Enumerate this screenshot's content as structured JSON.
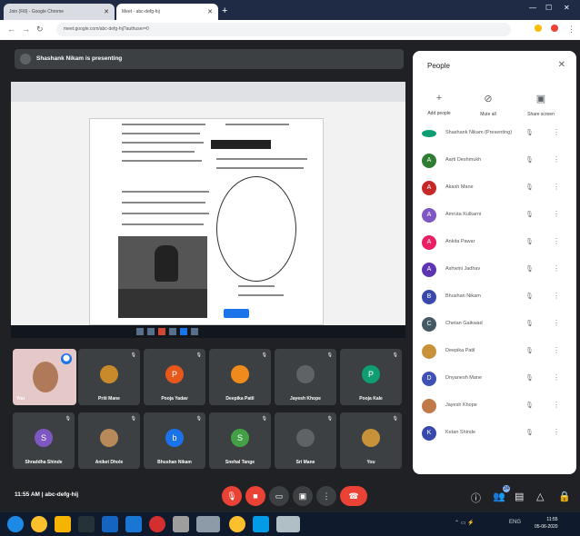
{
  "browser": {
    "tab1_title": "Join (Fill) - Google Chrome",
    "tab2_title": "Meet - abc-defg-hij",
    "new_tab": "+",
    "url": "meet.google.com/abc-defg-hij?authuser=0",
    "back_icon": "arrow-left-icon",
    "forward_icon": "arrow-right-icon",
    "reload_icon": "reload-icon"
  },
  "meet": {
    "presenting_label": "Shashank Nikam is presenting",
    "pinned_tile_name": "You",
    "tiles": [
      {
        "initial": "",
        "name": "Priti Mane",
        "color": "#c88a2a"
      },
      {
        "initial": "P",
        "name": "Pooja Yadav",
        "color": "#e8581c"
      },
      {
        "initial": "",
        "name": "Deepika Patil",
        "color": "#f08a1c"
      },
      {
        "initial": "",
        "name": "Jayesh Khope",
        "color": "#5f6368"
      },
      {
        "initial": "P",
        "name": "Pooja Kale",
        "color": "#0f9d74"
      },
      {
        "initial": "S",
        "name": "Shraddha Shinde",
        "color": "#7e57c2"
      },
      {
        "initial": "",
        "name": "Aniket Dhole",
        "color": "#b88a5a"
      },
      {
        "initial": "b",
        "name": "Bhushan Nikam",
        "color": "#1a73e8"
      },
      {
        "initial": "S",
        "name": "Snehal Tange",
        "color": "#43a047"
      },
      {
        "initial": "",
        "name": "Sri Mane",
        "color": "#5f6368"
      },
      {
        "initial": "",
        "name": "You",
        "color": "#c8923a"
      }
    ],
    "time": "11:55 AM",
    "meeting_code": "abc-defg-hij",
    "controls": {
      "mic_off": "mic-off-icon",
      "cam_off": "cam-off-icon",
      "captions": "captions-icon",
      "present": "present-icon",
      "more": "more-icon",
      "leave": "end-call-icon"
    },
    "participant_count": "24"
  },
  "people_panel": {
    "title": "People",
    "close": "✕",
    "actions": [
      {
        "icon": "add-person-icon",
        "label": "Add people"
      },
      {
        "icon": "mute-all-icon",
        "label": "Mute all"
      },
      {
        "icon": "screen-share-icon",
        "label": "Share screen"
      }
    ],
    "participants": [
      {
        "initial": "",
        "name": "Shashank Nikam (Presenting)",
        "color": "#0f9d74"
      },
      {
        "initial": "A",
        "name": "Aarti Deshmukh",
        "color": "#2e7d32"
      },
      {
        "initial": "A",
        "name": "Akash Mane",
        "color": "#c62828"
      },
      {
        "initial": "A",
        "name": "Amruta Kulkarni",
        "color": "#7e57c2"
      },
      {
        "initial": "A",
        "name": "Ankita Pawar",
        "color": "#e91e63"
      },
      {
        "initial": "A",
        "name": "Ashwini Jadhav",
        "color": "#5e35b1"
      },
      {
        "initial": "B",
        "name": "Bhushan Nikam",
        "color": "#3949ab"
      },
      {
        "initial": "C",
        "name": "Chetan Gaikwad",
        "color": "#455a64"
      },
      {
        "initial": "",
        "name": "Deepika Patil",
        "color": "#c8923a"
      },
      {
        "initial": "D",
        "name": "Dnyanesh Mane",
        "color": "#3f51b5"
      },
      {
        "initial": "",
        "name": "Jayesh Khope",
        "color": "#c07a4a"
      },
      {
        "initial": "K",
        "name": "Ketan Shinde",
        "color": "#3949ab"
      }
    ]
  },
  "taskbar": {
    "time": "11:55",
    "date": "05-06-2020",
    "lang": "ENG"
  }
}
